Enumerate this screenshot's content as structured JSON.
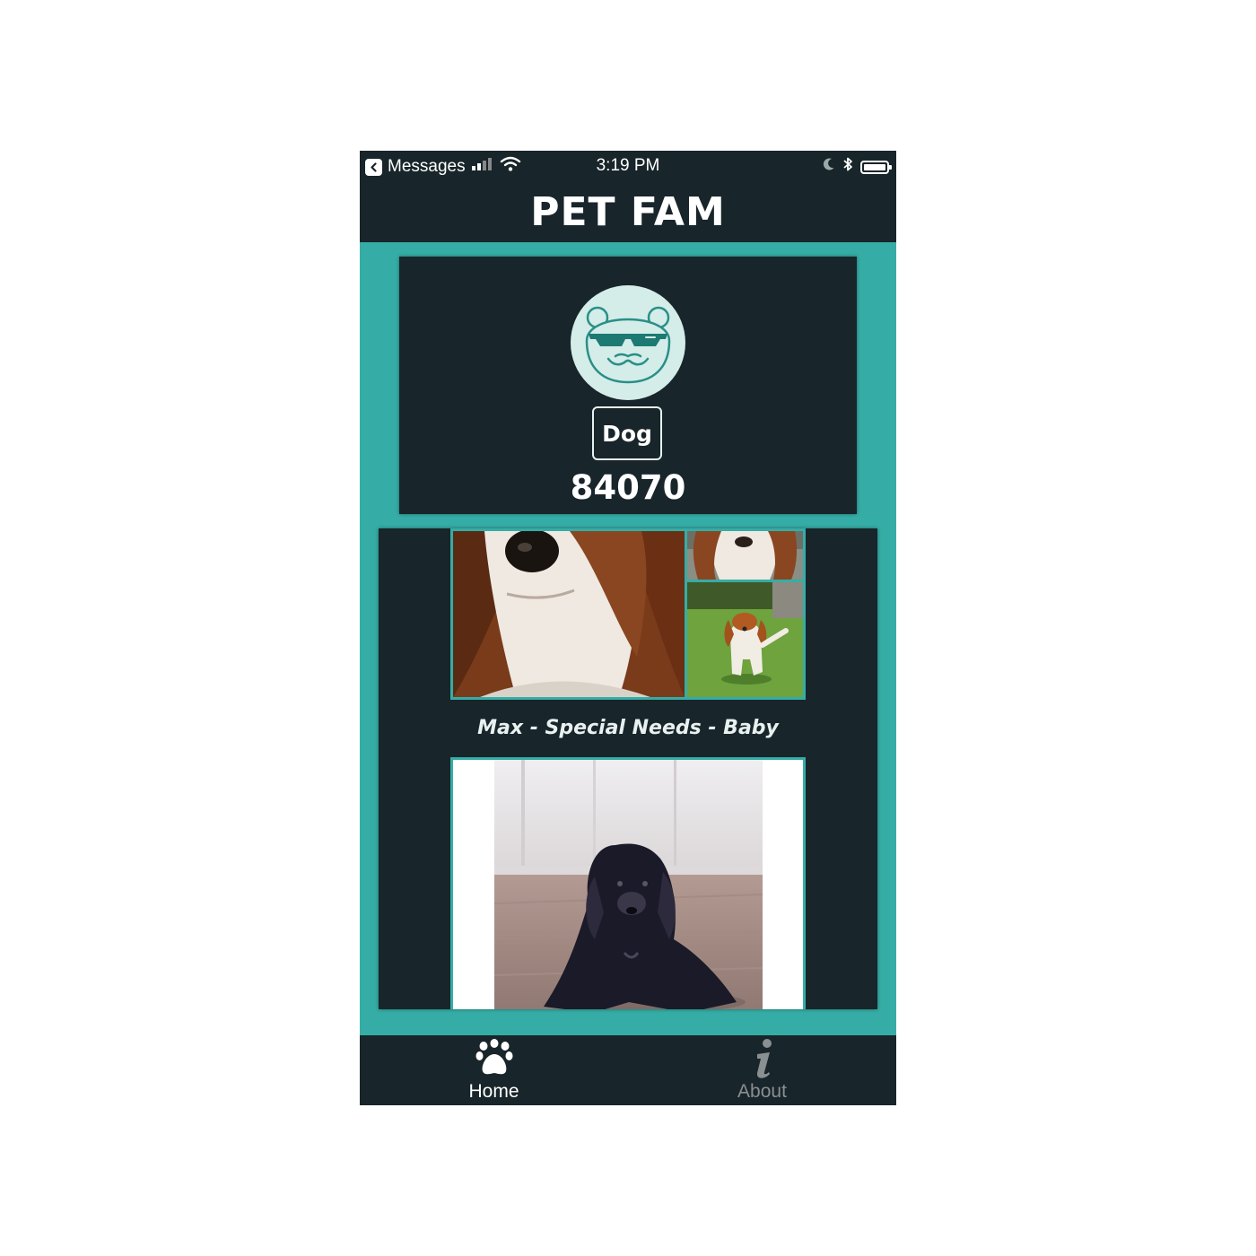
{
  "status_bar": {
    "back_app": "Messages",
    "time": "3:19 PM"
  },
  "header": {
    "title": "PET FAM"
  },
  "profile": {
    "avatar_icon": "bear-sunglasses-icon",
    "pet_type": "Dog",
    "zip_code": "84070"
  },
  "feed": {
    "posts": [
      {
        "caption": "Max - Special Needs - Baby"
      },
      {
        "caption": ""
      }
    ]
  },
  "tab_bar": {
    "tabs": [
      {
        "label": "Home",
        "icon": "paw-icon",
        "active": true
      },
      {
        "label": "About",
        "icon": "info-icon",
        "active": false
      }
    ]
  },
  "colors": {
    "background_teal": "#35ada6",
    "dark_navy": "#18252a",
    "avatar_bg": "#d4ede9",
    "inactive_tab": "#8a8f91"
  }
}
